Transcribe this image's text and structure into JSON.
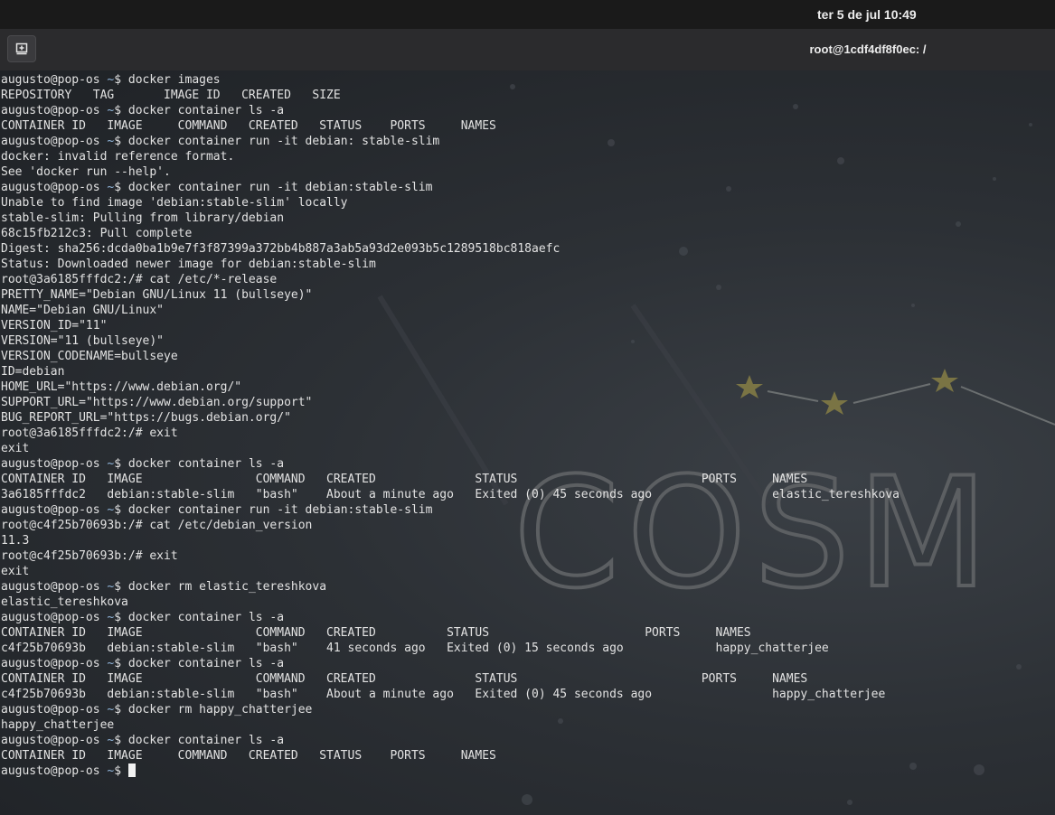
{
  "topbar": {
    "clock": "ter 5 de jul  10:49"
  },
  "window": {
    "title": "root@1cdf4df8f0ec: /",
    "new_tab_icon": "new-tab-icon"
  },
  "wallpaper": {
    "text": "COSM"
  },
  "prompt": {
    "user_host": "augusto@pop-os",
    "path": "~",
    "symbol": "$"
  },
  "lines": [
    {
      "p": true,
      "t": "docker images"
    },
    {
      "t": "REPOSITORY   TAG       IMAGE ID   CREATED   SIZE"
    },
    {
      "p": true,
      "t": "docker container ls -a"
    },
    {
      "t": "CONTAINER ID   IMAGE     COMMAND   CREATED   STATUS    PORTS     NAMES"
    },
    {
      "p": true,
      "t": "docker container run -it debian: stable-slim"
    },
    {
      "t": "docker: invalid reference format."
    },
    {
      "t": "See 'docker run --help'."
    },
    {
      "p": true,
      "t": "docker container run -it debian:stable-slim"
    },
    {
      "t": "Unable to find image 'debian:stable-slim' locally"
    },
    {
      "t": "stable-slim: Pulling from library/debian"
    },
    {
      "t": "68c15fb212c3: Pull complete"
    },
    {
      "t": "Digest: sha256:dcda0ba1b9e7f3f87399a372bb4b887a3ab5a93d2e093b5c1289518bc818aefc"
    },
    {
      "t": "Status: Downloaded newer image for debian:stable-slim"
    },
    {
      "t": "root@3a6185fffdc2:/# cat /etc/*-release"
    },
    {
      "t": "PRETTY_NAME=\"Debian GNU/Linux 11 (bullseye)\""
    },
    {
      "t": "NAME=\"Debian GNU/Linux\""
    },
    {
      "t": "VERSION_ID=\"11\""
    },
    {
      "t": "VERSION=\"11 (bullseye)\""
    },
    {
      "t": "VERSION_CODENAME=bullseye"
    },
    {
      "t": "ID=debian"
    },
    {
      "t": "HOME_URL=\"https://www.debian.org/\""
    },
    {
      "t": "SUPPORT_URL=\"https://www.debian.org/support\""
    },
    {
      "t": "BUG_REPORT_URL=\"https://bugs.debian.org/\""
    },
    {
      "t": "root@3a6185fffdc2:/# exit"
    },
    {
      "t": "exit"
    },
    {
      "p": true,
      "t": "docker container ls -a"
    },
    {
      "t": "CONTAINER ID   IMAGE                COMMAND   CREATED              STATUS                          PORTS     NAMES"
    },
    {
      "t": "3a6185fffdc2   debian:stable-slim   \"bash\"    About a minute ago   Exited (0) 45 seconds ago                 elastic_tereshkova"
    },
    {
      "p": true,
      "t": "docker container run -it debian:stable-slim"
    },
    {
      "t": "root@c4f25b70693b:/# cat /etc/debian_version"
    },
    {
      "t": "11.3"
    },
    {
      "t": "root@c4f25b70693b:/# exit"
    },
    {
      "t": "exit"
    },
    {
      "p": true,
      "t": "docker rm elastic_tereshkova"
    },
    {
      "t": "elastic_tereshkova"
    },
    {
      "p": true,
      "t": "docker container ls -a"
    },
    {
      "t": "CONTAINER ID   IMAGE                COMMAND   CREATED          STATUS                      PORTS     NAMES"
    },
    {
      "t": "c4f25b70693b   debian:stable-slim   \"bash\"    41 seconds ago   Exited (0) 15 seconds ago             happy_chatterjee"
    },
    {
      "p": true,
      "t": "docker container ls -a"
    },
    {
      "t": "CONTAINER ID   IMAGE                COMMAND   CREATED              STATUS                          PORTS     NAMES"
    },
    {
      "t": "c4f25b70693b   debian:stable-slim   \"bash\"    About a minute ago   Exited (0) 45 seconds ago                 happy_chatterjee"
    },
    {
      "p": true,
      "t": "docker rm happy_chatterjee"
    },
    {
      "t": "happy_chatterjee"
    },
    {
      "p": true,
      "t": "docker container ls -a"
    },
    {
      "t": "CONTAINER ID   IMAGE     COMMAND   CREATED   STATUS    PORTS     NAMES"
    },
    {
      "p": true,
      "t": "",
      "cursor": true
    }
  ]
}
